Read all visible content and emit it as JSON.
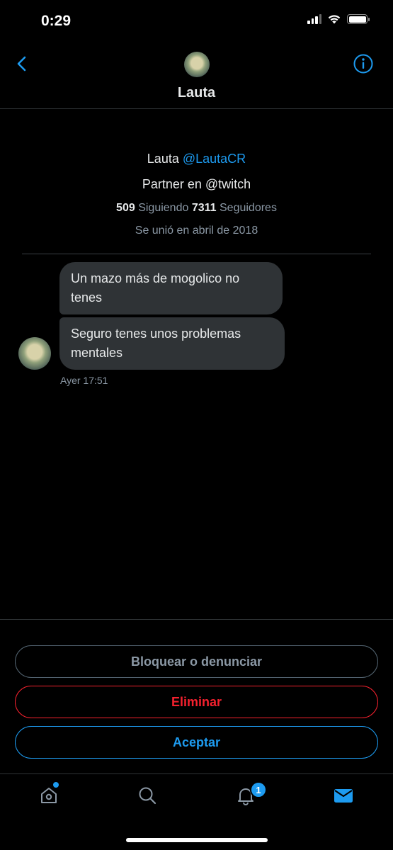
{
  "status_bar": {
    "time": "0:29"
  },
  "header": {
    "name": "Lauta"
  },
  "profile": {
    "name": "Lauta",
    "handle": "@LautaCR",
    "bio": "Partner en @twitch",
    "following_count": "509",
    "following_label": "Siguiendo",
    "followers_count": "7311",
    "followers_label": "Seguidores",
    "joined": "Se unió en abril de 2018"
  },
  "messages": [
    {
      "text": "Un mazo más de mogolico no tenes"
    },
    {
      "text": "Seguro tenes unos problemas mentales"
    }
  ],
  "message_timestamp": "Ayer 17:51",
  "actions": {
    "block_label": "Bloquear o denunciar",
    "delete_label": "Eliminar",
    "accept_label": "Aceptar"
  },
  "tab_bar": {
    "items": [
      "home-icon",
      "search-icon",
      "notifications-icon",
      "messages-icon"
    ],
    "notifications_badge": "1",
    "active": "messages"
  },
  "colors": {
    "accent": "#1d9bf0",
    "danger": "#f4212e",
    "bubble": "#2f3336",
    "background": "#000000"
  }
}
